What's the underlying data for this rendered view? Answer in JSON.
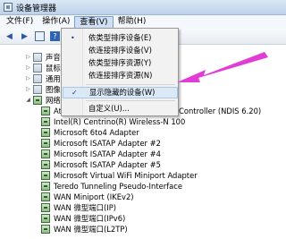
{
  "window": {
    "title": "设备管理器"
  },
  "menubar": {
    "items": [
      {
        "label": "文件(F)"
      },
      {
        "label": "操作(A)"
      },
      {
        "label": "查看(V)"
      },
      {
        "label": "帮助(H)"
      }
    ],
    "active": "查看(V)"
  },
  "toolbar": {
    "back_icon": "back-arrow-icon",
    "forward_icon": "forward-arrow-icon",
    "grid_icon": "grid-icon",
    "help_icon": "help-icon",
    "help_label": "?",
    "props_icon": "properties-icon"
  },
  "view_menu": {
    "items": [
      {
        "label": "依类型排序设备(E)",
        "mark": "•"
      },
      {
        "label": "依连接排序设备(V)",
        "mark": ""
      },
      {
        "label": "依类型排序资源(Y)",
        "mark": ""
      },
      {
        "label": "依连接排序资源(N)",
        "mark": ""
      },
      {
        "label": "显示隐藏的设备(W)",
        "mark": "✓"
      },
      {
        "label": "自定义(U)...",
        "mark": ""
      }
    ],
    "highlighted_index": 4
  },
  "tree": {
    "categories": [
      {
        "label": "声音、视"
      },
      {
        "label": "鼠标和其"
      },
      {
        "label": "通用串行"
      },
      {
        "label": "图像设备"
      },
      {
        "label": "网络适配"
      }
    ],
    "adapters": [
      {
        "label": "Ather",
        "suffix": "Controller (NDIS 6.20)"
      },
      {
        "label": "Intel(R) Centrino(R) Wireless-N 100"
      },
      {
        "label": "Microsoft 6to4 Adapter"
      },
      {
        "label": "Microsoft ISATAP Adapter #2"
      },
      {
        "label": "Microsoft ISATAP Adapter #4"
      },
      {
        "label": "Microsoft ISATAP Adapter #5"
      },
      {
        "label": "Microsoft Virtual WiFi Miniport Adapter"
      },
      {
        "label": "Teredo Tunneling Pseudo-Interface"
      },
      {
        "label": "WAN Miniport (IKEv2)"
      },
      {
        "label": "WAN 微型端口(IP)"
      },
      {
        "label": "WAN 微型端口(IPv6)"
      },
      {
        "label": "WAN 微型端口(L2TP)"
      }
    ]
  },
  "colors": {
    "arrow": "#e23bd6",
    "menu_highlight": "#dbe8f6"
  }
}
